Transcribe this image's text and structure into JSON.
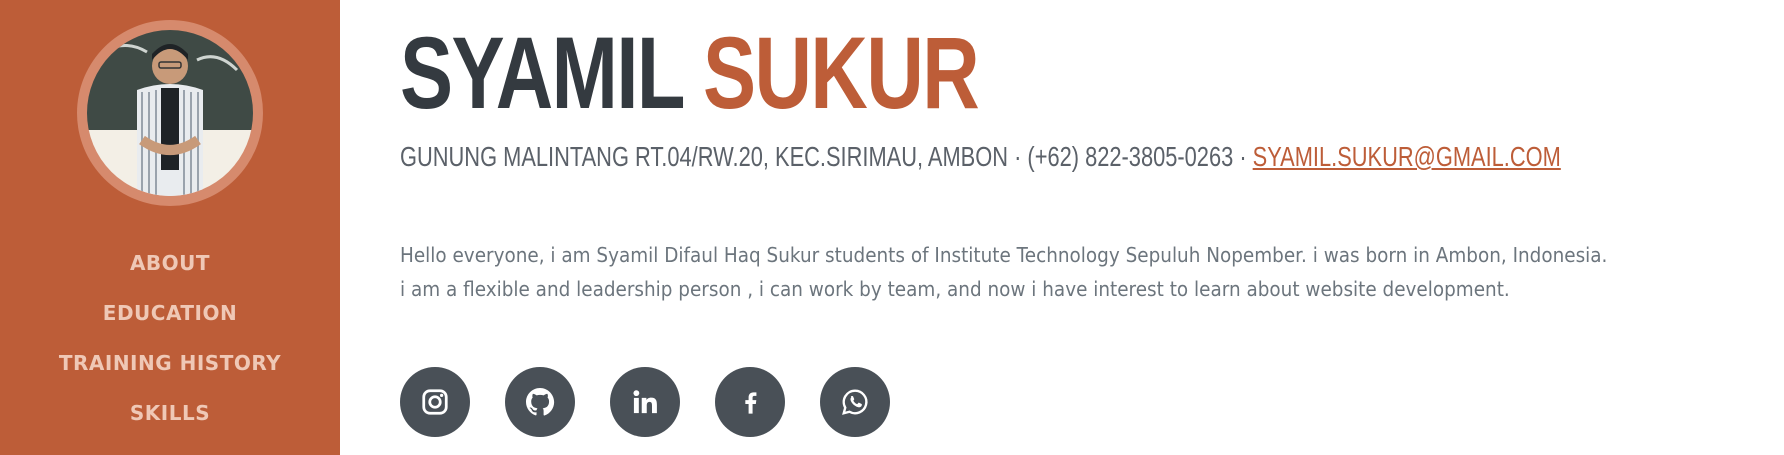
{
  "colors": {
    "primary": "#bd5d38",
    "primary_light": "#d68a6d",
    "nav_text": "#efc8b6",
    "dark": "#343a40",
    "muted": "#6c757d",
    "social_bg": "#495057"
  },
  "sidebar": {
    "avatar_icon": "profile-photo",
    "nav": [
      {
        "label": "ABOUT"
      },
      {
        "label": "EDUCATION"
      },
      {
        "label": "TRAINING HISTORY"
      },
      {
        "label": "SKILLS"
      }
    ]
  },
  "header": {
    "first_name": "SYAMIL",
    "last_name": "SUKUR"
  },
  "contact": {
    "address": "GUNUNG MALINTANG RT.04/RW.20, KEC.SIRIMAU, AMBON",
    "separator": "·",
    "phone": "(+62) 822-3805-0263",
    "email": "SYAMIL.SUKUR@GMAIL.COM"
  },
  "bio": {
    "line1": "Hello everyone, i am Syamil Difaul Haq Sukur students of Institute Technology Sepuluh Nopember. i was born in Ambon, Indonesia.",
    "line2": "i am a flexible and leadership person , i can work by team, and now i have interest to learn about website development."
  },
  "socials": [
    {
      "icon": "instagram-icon"
    },
    {
      "icon": "github-icon"
    },
    {
      "icon": "linkedin-icon"
    },
    {
      "icon": "facebook-icon"
    },
    {
      "icon": "whatsapp-icon"
    }
  ]
}
